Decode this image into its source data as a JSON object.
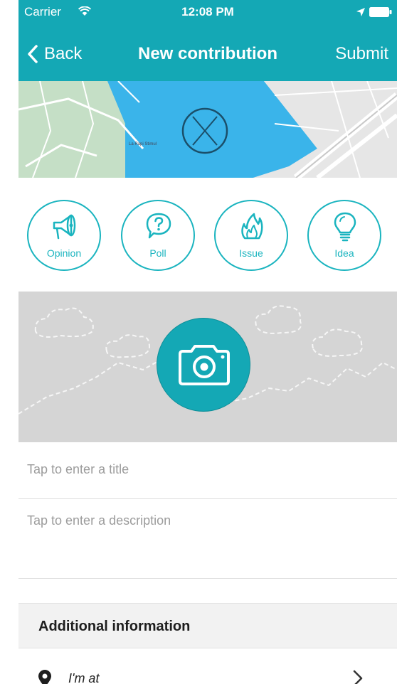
{
  "status_bar": {
    "carrier": "Carrier",
    "time": "12:08 PM"
  },
  "nav": {
    "back_label": "Back",
    "title": "New contribution",
    "submit_label": "Submit"
  },
  "map": {
    "label": "La Rapi Stimul"
  },
  "types": [
    {
      "label": "Opinion",
      "icon": "megaphone-icon"
    },
    {
      "label": "Poll",
      "icon": "question-bubble-icon"
    },
    {
      "label": "Issue",
      "icon": "flame-icon"
    },
    {
      "label": "Idea",
      "icon": "lightbulb-icon"
    }
  ],
  "form": {
    "title_placeholder": "Tap to enter a title",
    "description_placeholder": "Tap to enter a description"
  },
  "additional": {
    "header": "Additional information",
    "location_label": "I'm at"
  },
  "colors": {
    "accent": "#14a8b5",
    "water": "#3ab4ea",
    "photo_bg": "#d5d5d5"
  }
}
